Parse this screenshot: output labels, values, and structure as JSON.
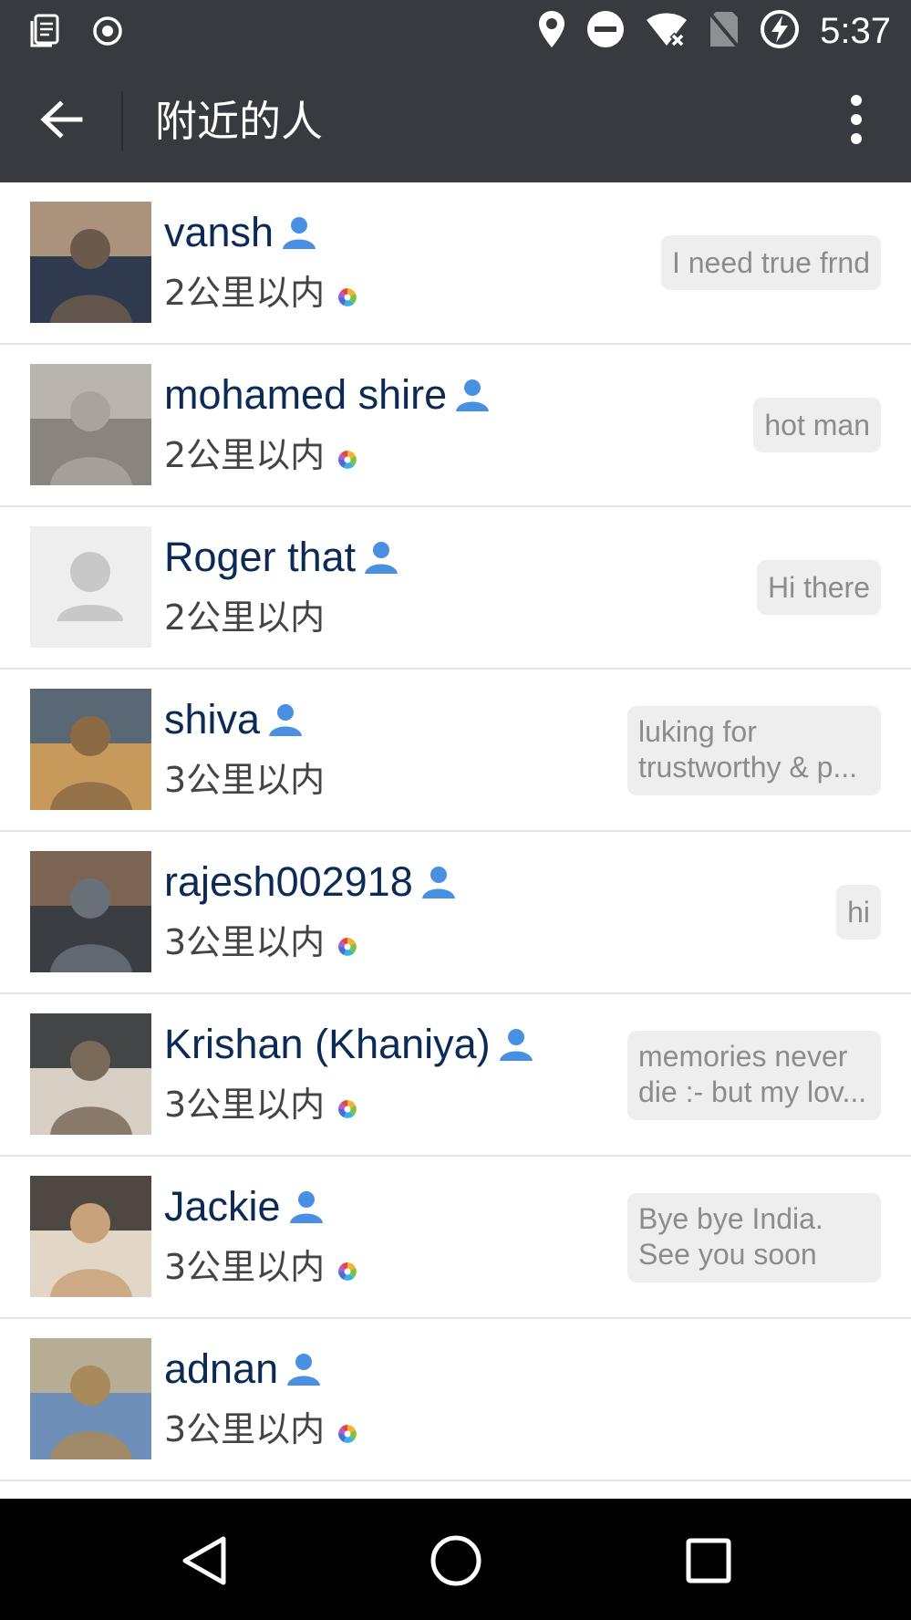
{
  "status_bar": {
    "time": "5:37",
    "icons_left": [
      "notes-icon",
      "record-icon"
    ],
    "icons_right": [
      "location-icon",
      "do-not-disturb-icon",
      "wifi-off-icon",
      "no-sim-icon",
      "battery-charging-icon"
    ]
  },
  "app_bar": {
    "title": "附近的人",
    "back_icon": "arrow-back-icon",
    "menu_icon": "more-vert-icon"
  },
  "rows": [
    {
      "name": "vansh",
      "distance": "2公里以内",
      "signature": "I need true  frnd",
      "avatar": "photo",
      "moments": true,
      "sig_lines": 1
    },
    {
      "name": "mohamed shire",
      "distance": "2公里以内",
      "signature": "hot man",
      "avatar": "photo",
      "moments": true,
      "sig_lines": 1
    },
    {
      "name": "Roger that",
      "distance": "2公里以内",
      "signature": "Hi there",
      "avatar": "default",
      "moments": false,
      "sig_lines": 1
    },
    {
      "name": "shiva",
      "distance": "3公里以内",
      "signature": "luking for trustworthy & p...",
      "avatar": "photo",
      "moments": false,
      "sig_lines": 2
    },
    {
      "name": "rajesh002918",
      "distance": "3公里以内",
      "signature": "hi",
      "avatar": "photo",
      "moments": true,
      "sig_lines": 1
    },
    {
      "name": "Krishan (Khaniya)",
      "distance": "3公里以内",
      "signature": "memories never die :- but my lov...",
      "avatar": "photo",
      "moments": true,
      "sig_lines": 2
    },
    {
      "name": "Jackie",
      "distance": "3公里以内",
      "signature": "Bye bye India. See you soon",
      "avatar": "photo",
      "moments": true,
      "sig_lines": 2
    },
    {
      "name": "adnan",
      "distance": "3公里以内",
      "signature": "",
      "avatar": "photo",
      "moments": true,
      "sig_lines": 0
    }
  ],
  "colors": {
    "app_bar": "#393a3f",
    "name_text": "#0b2a56",
    "male_icon": "#4a90e2",
    "signature_bg": "#eeeeee",
    "signature_text": "#8c8c8c"
  },
  "nav_bar": {
    "back": "nav-back-icon",
    "home": "nav-home-icon",
    "recents": "nav-recents-icon"
  }
}
